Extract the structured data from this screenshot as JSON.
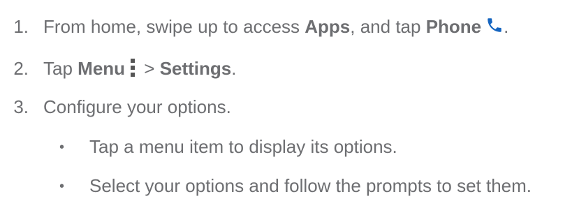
{
  "steps": [
    {
      "num": "1.",
      "pre": "From home, swipe up to access ",
      "bold1": "Apps",
      "mid": ", and tap ",
      "bold2": "Phone",
      "post": ".",
      "icon": "phone-icon"
    },
    {
      "num": "2.",
      "pre": "Tap ",
      "bold1": "Menu",
      "mid": " > ",
      "bold2": "Settings",
      "post": ".",
      "icon": "menu-icon"
    },
    {
      "num": "3.",
      "text": "Configure your options."
    }
  ],
  "bullets": [
    "Tap a menu item to display its options.",
    "Select your options and follow the prompts to set them."
  ],
  "bullet_symbol": "•",
  "colors": {
    "text": "#6d6e71",
    "phone_icon": "#1565c0"
  }
}
